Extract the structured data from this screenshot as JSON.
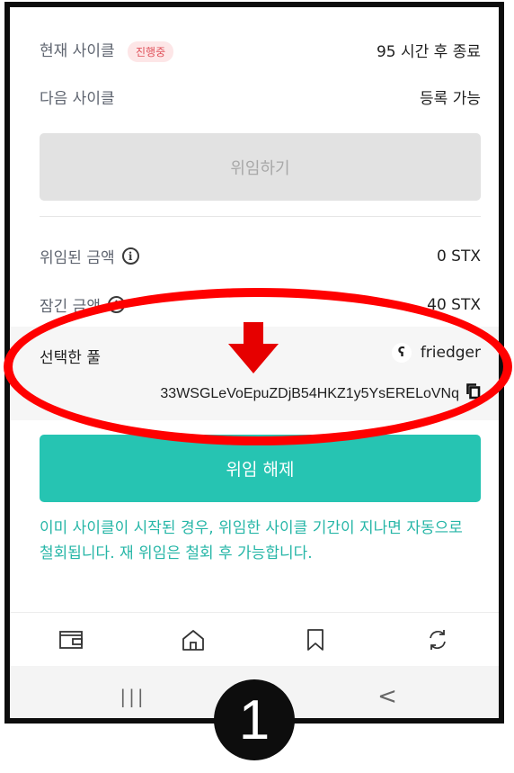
{
  "current_cycle": {
    "label": "현재 사이클",
    "status_badge": "진행중",
    "value": "95 시간 후 종료"
  },
  "next_cycle": {
    "label": "다음 사이클",
    "value": "등록 가능"
  },
  "delegate_button": {
    "label": "위임하기"
  },
  "delegated_amount": {
    "label": "위임된 금액",
    "value": "0 STX",
    "info_icon": "info-icon"
  },
  "locked_amount": {
    "label": "잠긴 금액",
    "value": "40 STX",
    "info_icon": "info-icon"
  },
  "selected_pool": {
    "label": "선택한 풀",
    "pool_name": "friedger",
    "pool_icon_glyph": "ʕ",
    "address": "33WSGLeVoEpuZDjB54HKZ1y5YsERELoVNq",
    "copy_icon": "copy-icon"
  },
  "revoke_button": {
    "label": "위임 해제"
  },
  "notice_text": "이미 사이클이 시작된 경우, 위임한 사이클 기간이 지나면 자동으로 철회됩니다. 재 위임은 철회 후 가능합니다.",
  "tabbar": {
    "items": [
      "wallet-icon",
      "home-icon",
      "bookmark-icon",
      "sync-icon"
    ]
  },
  "system_nav": {
    "recent_label": "|||",
    "back_label": "<"
  },
  "annotation": {
    "step_number": "1"
  },
  "colors": {
    "accent": "#26c4b2",
    "notice": "#26b6a7",
    "badge_text": "#e0525b",
    "badge_bg": "#fde6e7",
    "highlight": "#ff0000"
  }
}
